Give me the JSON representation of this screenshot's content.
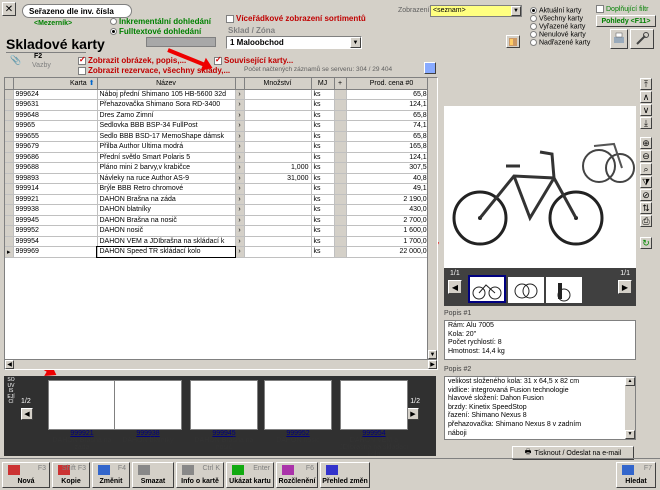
{
  "top": {
    "close": "✕",
    "sort_label": "Seřazeno dle inv. čísla",
    "mezernik": "<Mezerník>",
    "radio_incremental": "Inkrementální dohledání",
    "radio_fulltext": "Fulltextové dohledání",
    "multirow_label": "Víceřádkové zobrazení sortimentů",
    "sklad_label": "Sklad / Zóna",
    "sklad_value": "1  Maloobchod",
    "zobrazeni_label": "Zobrazení:",
    "zobrazeni_value": "<seznam>",
    "radios_cards": [
      "Aktuální karty",
      "Všechny karty",
      "Vyřazené karty",
      "Nenulové karty",
      "Nadřazené karty"
    ],
    "doplnujici_filtr": "Doplňující filtr",
    "pohledy": "Pohledy <F11>",
    "title": "Skladové karty",
    "show_images": "Zobrazit obrázek, popis,...",
    "show_reservations": "Zobrazit rezervace, všechny sklady,...",
    "related_cards": "Související karty...",
    "record_count": "Počet načtených záznamů se serveru: 304 / 29 404",
    "vazby": "Vazby"
  },
  "grid": {
    "headers": [
      "Karta",
      "Název",
      "Množství",
      "MJ",
      "+",
      "Prod. cena #0"
    ],
    "rows": [
      [
        "999624",
        "Náboj přední Shimano 105 HB-5600 32d",
        "",
        "ks",
        "65,833"
      ],
      [
        "999631",
        "Přehazovačka Shimano Sora RD-3400",
        "",
        "ks",
        "124,166"
      ],
      [
        "999648",
        "Dres Zamo Zimní",
        "",
        "ks",
        "65,833"
      ],
      [
        "99965",
        "Sedlovka BBB BSP-34 FullPost",
        "",
        "ks",
        "74,166"
      ],
      [
        "999655",
        "Sedlo BBB BSD-17 MemoShape dámsk",
        "",
        "ks",
        "65,833"
      ],
      [
        "999679",
        "Přilba Author Ultima modrá",
        "",
        "ks",
        "165,833"
      ],
      [
        "999686",
        "Přední světlo Smart Polaris 5",
        "",
        "ks",
        "124,166"
      ],
      [
        "999688",
        "Pláno mini 2 barvy,v krabičce",
        "1,000",
        "ks",
        "307,500"
      ],
      [
        "999893",
        "Návleky na ruce Author AS-9",
        "31,000",
        "ks",
        "40,830"
      ],
      [
        "999914",
        "Brýle BBB Retro chromové",
        "",
        "ks",
        "49,166"
      ],
      [
        "999921",
        "DAHON Brašna na záda",
        "",
        "ks",
        "2 190,000"
      ],
      [
        "999938",
        "DAHON blatníky",
        "",
        "ks",
        "430,000"
      ],
      [
        "999945",
        "DAHON Brašna na nosič",
        "",
        "ks",
        "2 700,000"
      ],
      [
        "999952",
        "DAHON nosič",
        "",
        "ks",
        "1 600,000"
      ],
      [
        "999954",
        "DAHON VEM a JDIbrašna na skládací k",
        "",
        "ks",
        "1 700,000"
      ],
      [
        "999969",
        "DAHON Speed TR skládací kolo",
        "",
        "ks",
        "22 000,000"
      ]
    ]
  },
  "gallery": {
    "page": "1/1",
    "page_right": "1/1"
  },
  "popis1": {
    "label": "Popis #1",
    "lines": [
      "Rám: Alu 7005",
      "Kola: 20\"",
      "Počet rychlostí: 8",
      "Hmotnost: 14,4 kg"
    ]
  },
  "popis2": {
    "label": "Popis #2",
    "lines": [
      "velikost složeného kola: 31 x 64,5 x 82 cm",
      "vidlice: integrovaná Fusion technologie",
      "hlavové složení: Dahon Fusion",
      "brzdy: Kinetix SpeedStop",
      "řazení: Shimano Nexus 8",
      "přehazovačka: Shimano Nexus  8 v zadním",
      "náboji"
    ]
  },
  "print_button": "Tisknout / Odeslat na e-mail",
  "strip": {
    "side_label": "SOUVISEJÍCÍ",
    "page": "1/2",
    "page_right": "1/2",
    "items": [
      {
        "num": "999921",
        "name": "DAHON Brašna na záda"
      },
      {
        "num": "999938",
        "name": "DAHON blatníky"
      },
      {
        "num": "999945",
        "name": "DAHON Brašna na nosič"
      },
      {
        "num": "999952",
        "name": "DAHON nosič"
      },
      {
        "num": "999954",
        "name": "DAHON VEM a JDIbrašna na skládací kolo"
      }
    ]
  },
  "toolbar": [
    {
      "label": "Nová",
      "key": "F3"
    },
    {
      "label": "Kopie",
      "key": "Shift F3"
    },
    {
      "label": "Změnit",
      "key": "F4"
    },
    {
      "label": "Smazat",
      "key": ""
    },
    {
      "label": "Info o kartě",
      "key": "Ctrl K"
    },
    {
      "label": "Ukázat kartu",
      "key": "Enter"
    },
    {
      "label": "Rozčlenění",
      "key": "F6"
    },
    {
      "label": "Přehled změn",
      "key": ""
    },
    {
      "label": "Hledat",
      "key": "F7"
    }
  ],
  "colors": {
    "accent_green": "#008000",
    "accent_red": "#c00000",
    "selection": "#000080"
  }
}
